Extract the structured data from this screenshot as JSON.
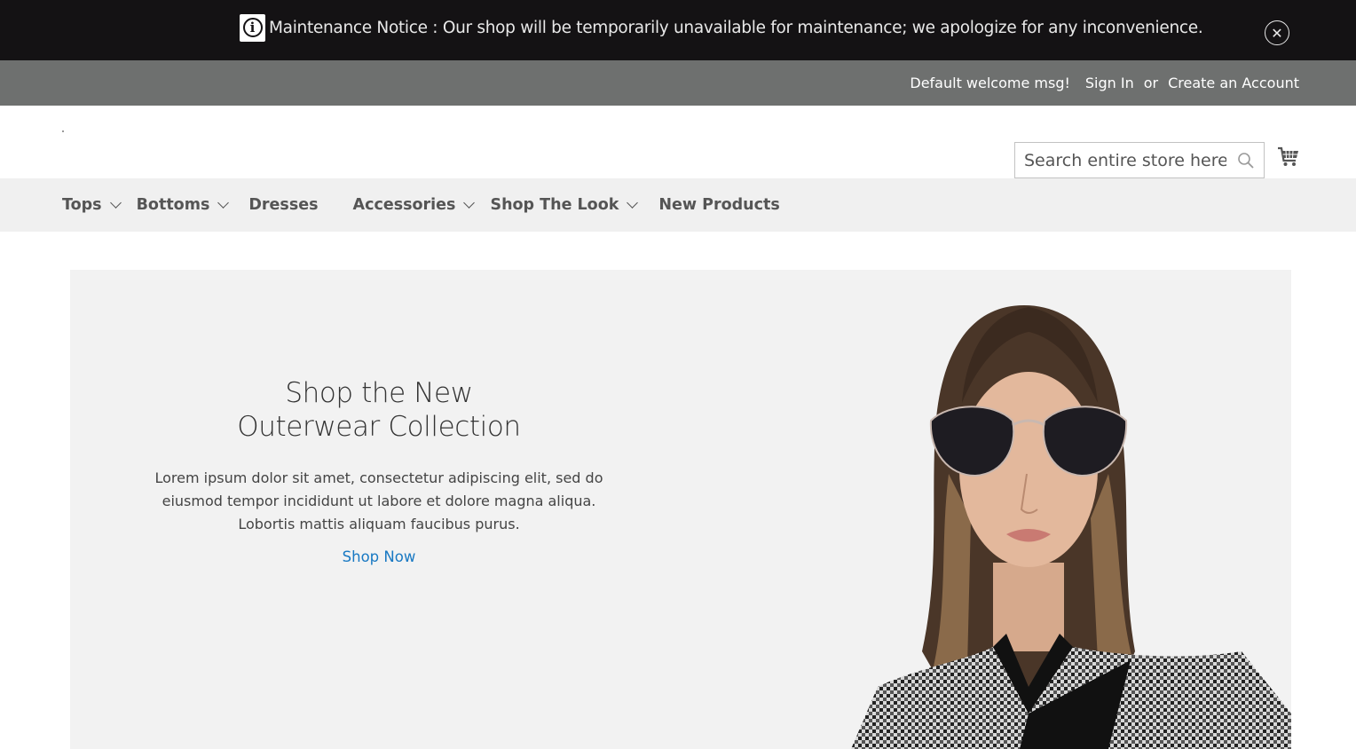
{
  "notice": {
    "text": "Maintenance Notice : Our shop will be temporarily unavailable for maintenance; we apologize for any inconvenience.",
    "icon": "info-icon",
    "close_icon": "close-icon"
  },
  "panel": {
    "welcome": "Default welcome msg!",
    "sign_in": "Sign In",
    "or": "or",
    "create_account": "Create an Account"
  },
  "header": {
    "search_placeholder": "Search entire store here...",
    "search_icon": "search-icon",
    "cart_icon": "cart-icon"
  },
  "nav": {
    "items": [
      {
        "label": "Tops",
        "has_submenu": true
      },
      {
        "label": "Bottoms",
        "has_submenu": true
      },
      {
        "label": "Dresses",
        "has_submenu": false
      },
      {
        "label": "Accessories",
        "has_submenu": true
      },
      {
        "label": "Shop The Look",
        "has_submenu": true
      },
      {
        "label": "New Products",
        "has_submenu": false
      }
    ]
  },
  "hero": {
    "title_line1": "Shop the New",
    "title_line2": "Outerwear Collection",
    "text": "Lorem ipsum dolor sit amet, consectetur adipiscing elit, sed do eiusmod tempor incididunt ut labore et dolore magna aliqua. Lobortis mattis aliquam faucibus purus.",
    "link": "Shop Now"
  },
  "colors": {
    "notice_bg": "#141214",
    "panel_bg": "#6e706f",
    "nav_bg": "#f0f0f0",
    "hero_bg": "#f2f2f2",
    "link": "#1979c3"
  }
}
